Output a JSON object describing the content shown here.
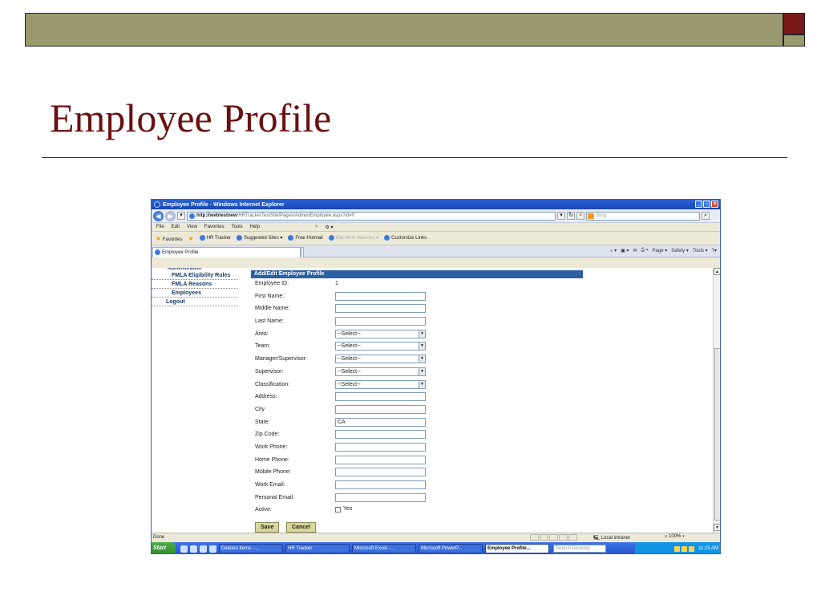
{
  "slide": {
    "title": "Employee Profile"
  },
  "window": {
    "title": "Employee Profile - Windows Internet Explorer",
    "address_host": "http://webtestnew",
    "address_path": "/HRTrackerTestSite/Pages/Admin/Employee.aspx?id=0",
    "search_placeholder": "Bing"
  },
  "menu": [
    "File",
    "Edit",
    "View",
    "Favorites",
    "Tools",
    "Help"
  ],
  "favorites": {
    "label": "Favorites",
    "items": [
      "HR Tracker",
      "Suggested Sites ▾",
      "Free Hotmail",
      "Get More Add-ons ▾",
      "Customize Links"
    ]
  },
  "tab": {
    "label": "Employee Profile"
  },
  "tab_tools": [
    "Page ▾",
    "Safety ▾",
    "Tools ▾"
  ],
  "sidebar": {
    "items": [
      {
        "label": "Administration"
      },
      {
        "label": "FMLA Eligibility Rules"
      },
      {
        "label": "FMLA Reasons"
      },
      {
        "label": "Employees"
      },
      {
        "label": "Logout"
      }
    ]
  },
  "form": {
    "header": "Add/Edit Employee Profile",
    "employee_id_label": "Employee ID:",
    "employee_id_value": "1",
    "first_name_label": "First Name:",
    "middle_name_label": "Middle Name:",
    "last_name_label": "Last Name:",
    "area_label": "Area:",
    "team_label": "Team:",
    "manager_label": "Manager/Supervisor:",
    "supervisor_label": "Supervisor:",
    "classification_label": "Classification:",
    "select_default": "--Select--",
    "address_label": "Address:",
    "city_label": "City",
    "state_label": "State:",
    "state_value": "CA",
    "zip_label": "Zip Code:",
    "work_phone_label": "Work Phone:",
    "home_phone_label": "Home Phone:",
    "mobile_phone_label": "Mobile Phone:",
    "work_email_label": "Work Email:",
    "personal_email_label": "Personal Email:",
    "active_label": "Active:",
    "active_option": "Yes",
    "save_label": "Save",
    "cancel_label": "Cancel"
  },
  "status": {
    "left": "Done",
    "zone": "Local intranet",
    "zoom": "100%"
  },
  "taskbar": {
    "start": "Start",
    "tasks": [
      "Deleted Items - ...",
      "HR Tracker",
      "Microsoft Excel - ...",
      "Microsoft PowerP...",
      "Employee Profile..."
    ],
    "search_placeholder": "Search Desktop",
    "clock": "11:25 AM"
  }
}
